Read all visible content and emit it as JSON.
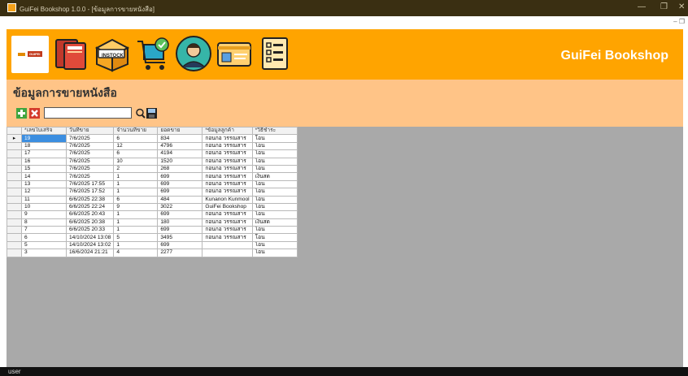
{
  "window": {
    "title": "GuiFei Bookshop 1.0.0 - [ข้อมูลการขายหนังสือ]",
    "minimize_glyph": "—",
    "restore_glyph": "❐",
    "close_glyph": "✕",
    "mdi_controls": "– ❐"
  },
  "header": {
    "brand": "GuiFei Bookshop",
    "logo_label": "GUIFEI",
    "instock_label": "INSTOCK",
    "icons": [
      "logo-icon",
      "books-icon",
      "instock-box-icon",
      "shopping-cart-icon",
      "user-avatar-icon",
      "member-card-icon",
      "report-list-icon"
    ],
    "accent_color": "#ffa400"
  },
  "panel": {
    "title": "ข้อมูลการขายหนังสือ",
    "search_value": "",
    "search_placeholder": ""
  },
  "grid": {
    "columns": [
      "*เลขใบเสร็จ",
      "วันที่ขาย",
      "จำนวนที่ขาย",
      "ยอดขาย",
      "*ข้อมูลลูกค้า",
      "*วิธีชำระ"
    ],
    "rows": [
      [
        "19",
        "7/6/2025",
        "6",
        "834",
        "กอนกอ วรรณสาร",
        "โอน"
      ],
      [
        "18",
        "7/6/2025",
        "12",
        "4796",
        "กอนกอ วรรณสาร",
        "โอน"
      ],
      [
        "17",
        "7/6/2025",
        "6",
        "4194",
        "กอนกอ วรรณสาร",
        "โอน"
      ],
      [
        "16",
        "7/6/2025",
        "10",
        "1520",
        "กอนกอ วรรณสาร",
        "โอน"
      ],
      [
        "15",
        "7/6/2025",
        "2",
        "268",
        "กอนกอ วรรณสาร",
        "โอน"
      ],
      [
        "14",
        "7/6/2025",
        "1",
        "699",
        "กอนกอ วรรณสาร",
        "เงินสด"
      ],
      [
        "13",
        "7/6/2025 17:55",
        "1",
        "699",
        "กอนกอ วรรณสาร",
        "โอน"
      ],
      [
        "12",
        "7/6/2025 17:52",
        "1",
        "699",
        "กอนกอ วรรณสาร",
        "โอน"
      ],
      [
        "11",
        "6/6/2025 22:38",
        "6",
        "484",
        "Kunanon Kunmool",
        "โอน"
      ],
      [
        "10",
        "6/6/2025 22:24",
        "9",
        "3022",
        "GuiFei Bookshop",
        "โอน"
      ],
      [
        "9",
        "6/6/2025 20:43",
        "1",
        "699",
        "กอนกอ วรรณสาร",
        "โอน"
      ],
      [
        "8",
        "6/6/2025 20:38",
        "1",
        "180",
        "กอนกอ วรรณสาร",
        "เงินสด"
      ],
      [
        "7",
        "6/6/2025 20:33",
        "1",
        "699",
        "กอนกอ วรรณสาร",
        "โอน"
      ],
      [
        "6",
        "14/10/2024 13:08",
        "5",
        "3495",
        "กอนกอ วรรณสาร",
        "โอน"
      ],
      [
        "5",
        "14/10/2024 13:02",
        "1",
        "699",
        "",
        "โอน"
      ],
      [
        "3",
        "16/6/2024 21:21",
        "4",
        "2277",
        "",
        "โอน"
      ]
    ],
    "current_row_marker": "▸"
  },
  "status": {
    "text": "user"
  }
}
